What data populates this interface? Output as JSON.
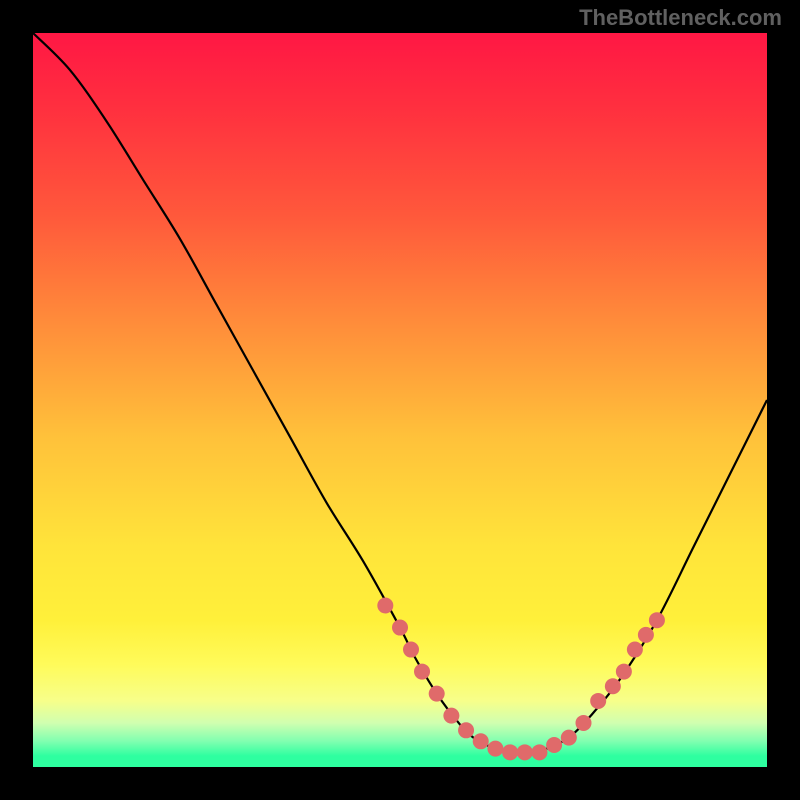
{
  "watermark": "TheBottleneck.com",
  "chart_data": {
    "type": "line",
    "title": "",
    "xlabel": "",
    "ylabel": "",
    "xlim": [
      0,
      100
    ],
    "ylim": [
      0,
      100
    ],
    "gradient_stops": [
      {
        "offset": 0.0,
        "color": "#ff1744"
      },
      {
        "offset": 0.1,
        "color": "#ff2f3f"
      },
      {
        "offset": 0.25,
        "color": "#ff593b"
      },
      {
        "offset": 0.4,
        "color": "#ff8e3a"
      },
      {
        "offset": 0.55,
        "color": "#ffc13a"
      },
      {
        "offset": 0.7,
        "color": "#ffe43a"
      },
      {
        "offset": 0.8,
        "color": "#fff03a"
      },
      {
        "offset": 0.86,
        "color": "#fffb5a"
      },
      {
        "offset": 0.91,
        "color": "#f7ff8a"
      },
      {
        "offset": 0.94,
        "color": "#d0ffb0"
      },
      {
        "offset": 0.965,
        "color": "#80ffb0"
      },
      {
        "offset": 0.985,
        "color": "#2effa0"
      },
      {
        "offset": 1.0,
        "color": "#2effa0"
      }
    ],
    "series": [
      {
        "name": "bottleneck-curve",
        "x": [
          0,
          5,
          10,
          15,
          20,
          25,
          30,
          35,
          40,
          45,
          50,
          52,
          55,
          58,
          60,
          63,
          66,
          68,
          70,
          73,
          76,
          80,
          85,
          90,
          95,
          100
        ],
        "y": [
          100,
          95,
          88,
          80,
          72,
          63,
          54,
          45,
          36,
          28,
          19,
          15,
          10,
          6,
          4,
          2.5,
          2,
          2,
          2.5,
          4,
          7,
          12,
          20,
          30,
          40,
          50
        ]
      }
    ],
    "markers": {
      "name": "highlight-dots",
      "color": "#e06a6a",
      "radius": 8,
      "points": [
        {
          "x": 48,
          "y": 22
        },
        {
          "x": 50,
          "y": 19
        },
        {
          "x": 51.5,
          "y": 16
        },
        {
          "x": 53,
          "y": 13
        },
        {
          "x": 55,
          "y": 10
        },
        {
          "x": 57,
          "y": 7
        },
        {
          "x": 59,
          "y": 5
        },
        {
          "x": 61,
          "y": 3.5
        },
        {
          "x": 63,
          "y": 2.5
        },
        {
          "x": 65,
          "y": 2
        },
        {
          "x": 67,
          "y": 2
        },
        {
          "x": 69,
          "y": 2
        },
        {
          "x": 71,
          "y": 3
        },
        {
          "x": 73,
          "y": 4
        },
        {
          "x": 75,
          "y": 6
        },
        {
          "x": 77,
          "y": 9
        },
        {
          "x": 79,
          "y": 11
        },
        {
          "x": 80.5,
          "y": 13
        },
        {
          "x": 82,
          "y": 16
        },
        {
          "x": 83.5,
          "y": 18
        },
        {
          "x": 85,
          "y": 20
        }
      ]
    }
  }
}
